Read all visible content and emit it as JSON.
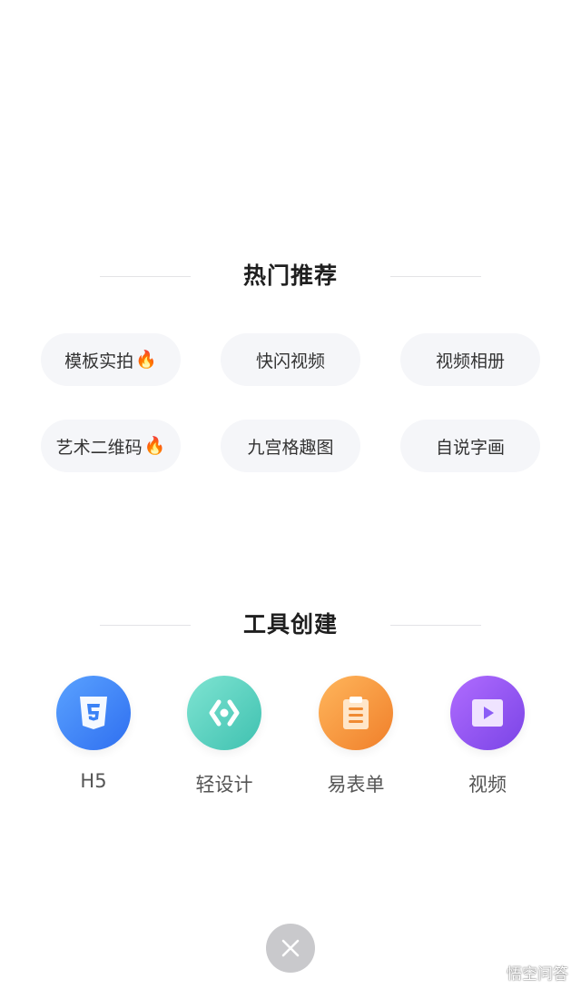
{
  "hot": {
    "title": "热门推荐",
    "items": [
      {
        "label": "模板实拍",
        "fire": true
      },
      {
        "label": "快闪视频",
        "fire": false
      },
      {
        "label": "视频相册",
        "fire": false
      },
      {
        "label": "艺术二维码",
        "fire": true
      },
      {
        "label": "九宫格趣图",
        "fire": false
      },
      {
        "label": "自说字画",
        "fire": false
      }
    ]
  },
  "tools": {
    "title": "工具创建",
    "items": [
      {
        "label": "H5",
        "icon": "html5-icon",
        "color": "#3b82f6"
      },
      {
        "label": "轻设计",
        "icon": "light-design-icon",
        "color": "#5fd3c0"
      },
      {
        "label": "易表单",
        "icon": "form-icon",
        "color": "#f59a3c"
      },
      {
        "label": "视频",
        "icon": "video-play-icon",
        "color": "#8b5cf6"
      }
    ]
  },
  "watermark": {
    "text": "悟空问答"
  }
}
